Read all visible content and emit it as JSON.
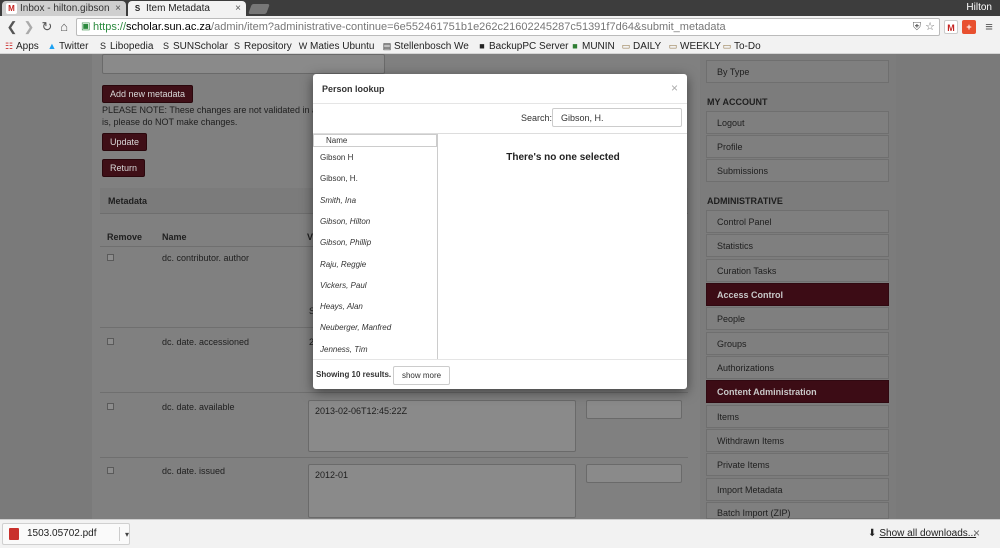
{
  "browser": {
    "tabs": [
      {
        "title": "Inbox - hilton.gibson",
        "icon": "gmail-icon"
      },
      {
        "title": "Item Metadata",
        "icon": "sun-scholar-icon"
      }
    ],
    "profile_name": "Hilton",
    "url": {
      "scheme": "https://",
      "host": "scholar.sun.ac.za",
      "path": "/admin/item?administrative-continue=6e552461751b1e262c21602245287c51391f7d64&submit_metadata"
    },
    "bookmarks": [
      {
        "label": "Apps",
        "icon": "apps-grid-icon"
      },
      {
        "label": "Twitter",
        "icon": "twitter-bird-icon"
      },
      {
        "label": "Libopedia",
        "icon": "sun-scholar-icon"
      },
      {
        "label": "SUNScholar",
        "icon": "sun-scholar-icon"
      },
      {
        "label": "Repository",
        "icon": "sun-scholar-icon"
      },
      {
        "label": "Maties Ubuntu",
        "icon": "wikipedia-icon"
      },
      {
        "label": "Stellenbosch We",
        "icon": "site-icon"
      },
      {
        "label": "BackupPC Server",
        "icon": "backuppc-icon"
      },
      {
        "label": "MUNIN",
        "icon": "munin-icon"
      },
      {
        "label": "DAILY",
        "icon": "folder-icon"
      },
      {
        "label": "WEEKLY",
        "icon": "folder-icon"
      },
      {
        "label": "To-Do",
        "icon": "folder-icon"
      }
    ]
  },
  "page": {
    "add_metadata_button": "Add new metadata",
    "note_line1": "PLEASE NOTE: These changes are not validated in any way",
    "note_line2": "is, please do NOT make changes.",
    "update_button": "Update",
    "return_button": "Return",
    "metadata_header": "Metadata",
    "columns": {
      "remove": "Remove",
      "name": "Name",
      "value": "V"
    },
    "rows": [
      {
        "name": "dc. contributor. author"
      },
      {
        "name": "dc. date. accessioned"
      },
      {
        "name": "dc. date. available",
        "value": "2013-02-06T12:45:22Z"
      },
      {
        "name": "dc. date. issued",
        "value": "2012-01"
      }
    ],
    "value_fragments": [
      "S",
      "2",
      "3",
      "2"
    ]
  },
  "sidebar": {
    "top_item": "By Type",
    "my_account_title": "MY ACCOUNT",
    "account_items": [
      "Logout",
      "Profile",
      "Submissions"
    ],
    "admin_title": "ADMINISTRATIVE",
    "admin_items": [
      {
        "label": "Control Panel",
        "active": false
      },
      {
        "label": "Statistics",
        "active": false
      },
      {
        "label": "Curation Tasks",
        "active": false
      },
      {
        "label": "Access Control",
        "active": true
      },
      {
        "label": "People",
        "active": false
      },
      {
        "label": "Groups",
        "active": false
      },
      {
        "label": "Authorizations",
        "active": false
      },
      {
        "label": "Content Administration",
        "active": true
      },
      {
        "label": "Items",
        "active": false
      },
      {
        "label": "Withdrawn Items",
        "active": false
      },
      {
        "label": "Private Items",
        "active": false
      },
      {
        "label": "Import Metadata",
        "active": false
      },
      {
        "label": "Batch Import (ZIP)",
        "active": false
      }
    ]
  },
  "modal": {
    "title": "Person lookup",
    "close_symbol": "×",
    "search_label": "Search:",
    "search_value": "Gibson, H.",
    "list_header": "Name",
    "people": [
      {
        "name": "Gibson H",
        "italic": false
      },
      {
        "name": "Gibson, H.",
        "italic": false
      },
      {
        "name": "Smith, Ina",
        "italic": true
      },
      {
        "name": "Gibson, Hilton",
        "italic": true
      },
      {
        "name": "Gibson, Phillip",
        "italic": true
      },
      {
        "name": "Raju, Reggie",
        "italic": true
      },
      {
        "name": "Vickers, Paul",
        "italic": true
      },
      {
        "name": "Heays, Alan",
        "italic": true
      },
      {
        "name": "Neuberger, Manfred",
        "italic": true
      },
      {
        "name": "Jenness, Tim",
        "italic": true
      }
    ],
    "no_selection": "There's no one selected",
    "results_text": "Showing 10 results.",
    "show_more": "show more"
  },
  "downloads": {
    "file_name": "1503.05702.pdf",
    "show_all": "Show all downloads...",
    "close_symbol": "×"
  }
}
